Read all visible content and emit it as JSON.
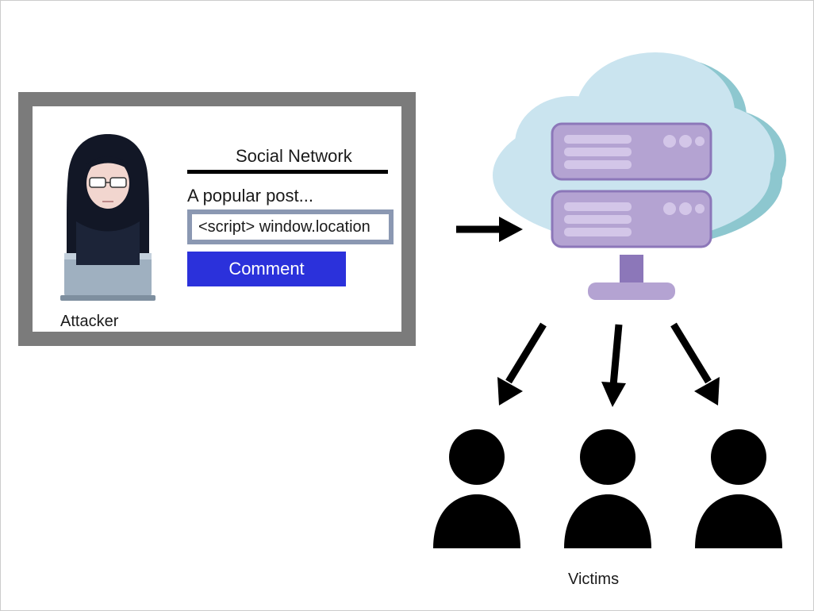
{
  "attacker": {
    "label": "Attacker"
  },
  "social_panel": {
    "title": "Social Network",
    "post_title": "A popular post...",
    "comment_value": "<script> window.location",
    "comment_button": "Comment"
  },
  "victims": {
    "label": "Victims"
  },
  "colors": {
    "panel_border": "#7b7b7b",
    "input_border": "#8b98b2",
    "button_bg": "#2b31db",
    "cloud_fill": "#cae4ef",
    "cloud_shadow": "#8dc7cf",
    "server_body": "#b4a3d2",
    "server_accent": "#8c77b9",
    "server_light": "#d3c6e8"
  }
}
